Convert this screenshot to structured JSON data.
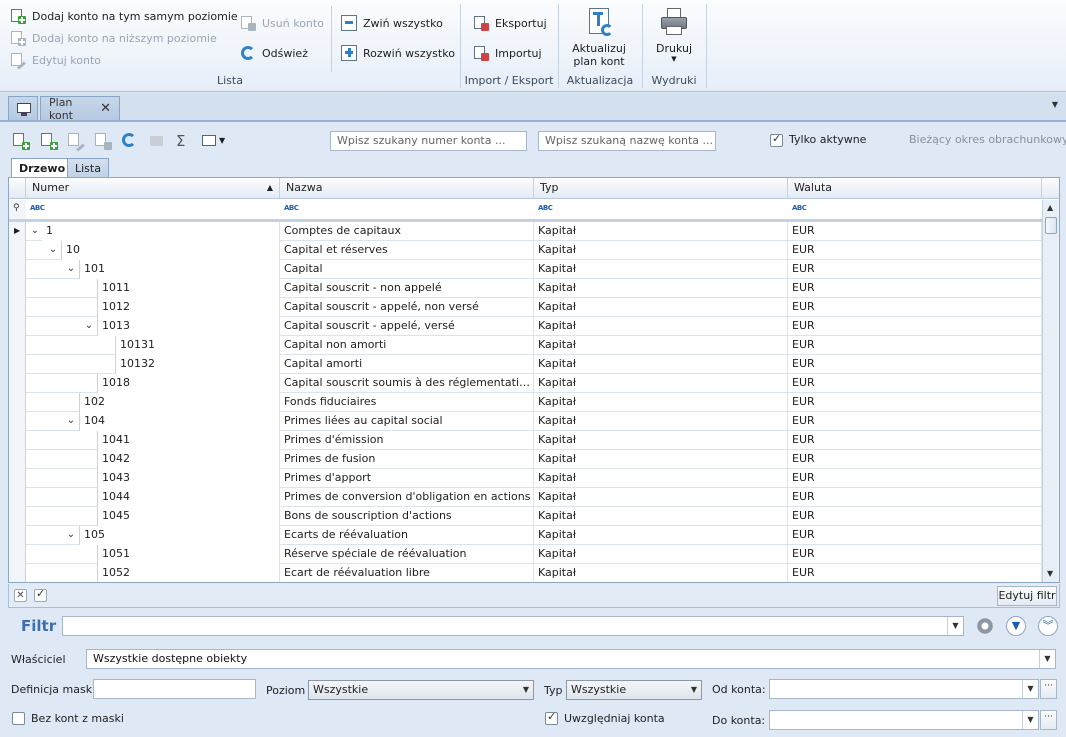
{
  "ribbon": {
    "lista": {
      "add_same": "Dodaj konto na tym samym poziomie",
      "add_lower": "Dodaj konto na niższym poziomie",
      "edit": "Edytuj konto",
      "remove": "Usuń konto",
      "refresh": "Odśwież",
      "collapse": "Zwiń wszystko",
      "expand": "Rozwiń wszystko",
      "label": "Lista"
    },
    "import_export": {
      "export": "Eksportuj",
      "import": "Importuj",
      "label": "Import / Eksport"
    },
    "aktualizacja": {
      "update_line1": "Aktualizuj",
      "update_line2": "plan kont",
      "label": "Aktualizacja"
    },
    "wydruki": {
      "print": "Drukuj",
      "label": "Wydruki"
    }
  },
  "tabs": {
    "plan_kont": "Plan kont"
  },
  "toolbar": {
    "search_number_placeholder": "Wpisz szukany numer konta ...",
    "search_name_placeholder": "Wpisz szukaną nazwę konta ...",
    "only_active": "Tylko aktywne",
    "period_label": "Bieżący okres obrachunkowy:"
  },
  "subtabs": {
    "tree": "Drzewo",
    "list": "Lista"
  },
  "grid": {
    "columns": {
      "numer": "Numer",
      "nazwa": "Nazwa",
      "typ": "Typ",
      "waluta": "Waluta"
    },
    "filter_abc": "ABC",
    "rows": [
      {
        "level": 0,
        "numer": "1",
        "nazwa": "Comptes de capitaux",
        "typ": "Kapitał",
        "waluta": "EUR",
        "expandable": true,
        "current": true
      },
      {
        "level": 1,
        "numer": "10",
        "nazwa": "Capital et réserves",
        "typ": "Kapitał",
        "waluta": "EUR",
        "expandable": true
      },
      {
        "level": 2,
        "numer": "101",
        "nazwa": "Capital",
        "typ": "Kapitał",
        "waluta": "EUR",
        "expandable": true
      },
      {
        "level": 3,
        "numer": "1011",
        "nazwa": "Capital souscrit - non appelé",
        "typ": "Kapitał",
        "waluta": "EUR",
        "expandable": false
      },
      {
        "level": 3,
        "numer": "1012",
        "nazwa": "Capital souscrit - appelé, non versé",
        "typ": "Kapitał",
        "waluta": "EUR",
        "expandable": false
      },
      {
        "level": 3,
        "numer": "1013",
        "nazwa": "Capital souscrit - appelé, versé",
        "typ": "Kapitał",
        "waluta": "EUR",
        "expandable": true
      },
      {
        "level": 4,
        "numer": "10131",
        "nazwa": "Capital non amorti",
        "typ": "Kapitał",
        "waluta": "EUR",
        "expandable": false
      },
      {
        "level": 4,
        "numer": "10132",
        "nazwa": "Capital amorti",
        "typ": "Kapitał",
        "waluta": "EUR",
        "expandable": false
      },
      {
        "level": 3,
        "numer": "1018",
        "nazwa": "Capital souscrit soumis à des réglementations...",
        "typ": "Kapitał",
        "waluta": "EUR",
        "expandable": false
      },
      {
        "level": 2,
        "numer": "102",
        "nazwa": "Fonds fiduciaires",
        "typ": "Kapitał",
        "waluta": "EUR",
        "expandable": false
      },
      {
        "level": 2,
        "numer": "104",
        "nazwa": "Primes liées au capital social",
        "typ": "Kapitał",
        "waluta": "EUR",
        "expandable": true
      },
      {
        "level": 3,
        "numer": "1041",
        "nazwa": "Primes d'émission",
        "typ": "Kapitał",
        "waluta": "EUR",
        "expandable": false
      },
      {
        "level": 3,
        "numer": "1042",
        "nazwa": "Primes de fusion",
        "typ": "Kapitał",
        "waluta": "EUR",
        "expandable": false
      },
      {
        "level": 3,
        "numer": "1043",
        "nazwa": "Primes d'apport",
        "typ": "Kapitał",
        "waluta": "EUR",
        "expandable": false
      },
      {
        "level": 3,
        "numer": "1044",
        "nazwa": "Primes de conversion d'obligation en actions",
        "typ": "Kapitał",
        "waluta": "EUR",
        "expandable": false
      },
      {
        "level": 3,
        "numer": "1045",
        "nazwa": "Bons de souscription d'actions",
        "typ": "Kapitał",
        "waluta": "EUR",
        "expandable": false
      },
      {
        "level": 2,
        "numer": "105",
        "nazwa": "Ecarts de réévaluation",
        "typ": "Kapitał",
        "waluta": "EUR",
        "expandable": true
      },
      {
        "level": 3,
        "numer": "1051",
        "nazwa": "Réserve spéciale de réévaluation",
        "typ": "Kapitał",
        "waluta": "EUR",
        "expandable": false
      },
      {
        "level": 3,
        "numer": "1052",
        "nazwa": "Ecart de réévaluation libre",
        "typ": "Kapitał",
        "waluta": "EUR",
        "expandable": false
      }
    ]
  },
  "grid_footer": {
    "edit_filter": "Edytuj filtr"
  },
  "filter": {
    "label": "Filtr",
    "value": ""
  },
  "form": {
    "owner_label": "Właściciel",
    "owner_value": "Wszystkie dostępne obiekty",
    "mask_label": "Definicja maski",
    "mask_value": "",
    "level_label": "Poziom",
    "level_value": "Wszystkie",
    "type_label": "Typ",
    "type_value": "Wszystkie",
    "from_label": "Od konta:",
    "from_value": "",
    "to_label": "Do konta:",
    "to_value": "",
    "no_mask_label": "Bez kont z maski",
    "include_label": "Uwzględniaj konta"
  },
  "colors": {
    "accent": "#1f5fa8",
    "header_bg": "#dfe9f5",
    "border": "#8ea7c2"
  }
}
